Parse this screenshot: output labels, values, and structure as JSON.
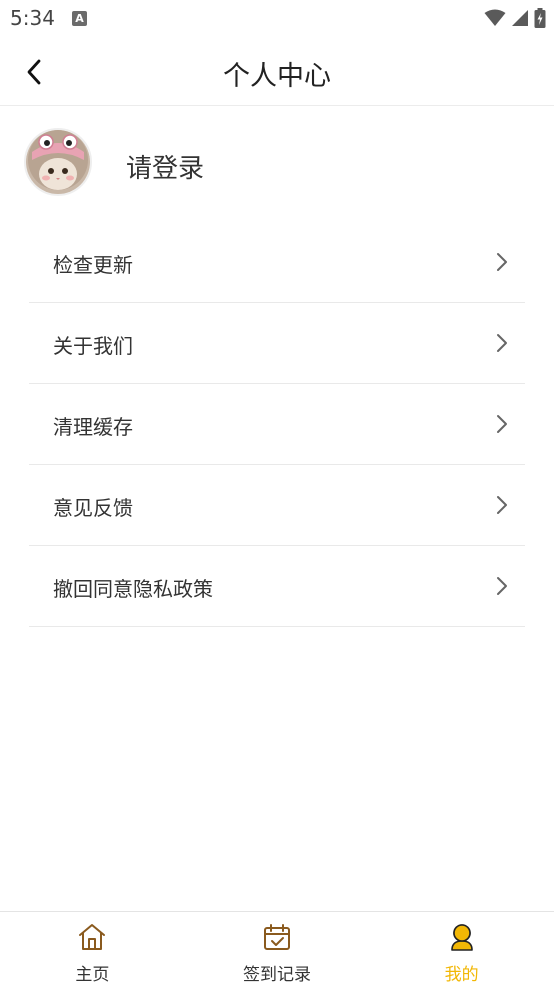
{
  "status_bar": {
    "time": "5:34",
    "notif_letter": "A"
  },
  "header": {
    "title": "个人中心",
    "back_icon": "chevron-left-icon"
  },
  "profile": {
    "login_text": "请登录",
    "avatar": "avatar-cat-image"
  },
  "menu": {
    "items": [
      {
        "label": "检查更新"
      },
      {
        "label": "关于我们"
      },
      {
        "label": "清理缓存"
      },
      {
        "label": "意见反馈"
      },
      {
        "label": "撤回同意隐私政策"
      }
    ]
  },
  "tabbar": {
    "tabs": [
      {
        "label": "主页",
        "icon": "home-icon",
        "active": false
      },
      {
        "label": "签到记录",
        "icon": "calendar-check-icon",
        "active": false
      },
      {
        "label": "我的",
        "icon": "user-icon",
        "active": true
      }
    ]
  },
  "colors": {
    "accent": "#f2b705",
    "icon_brown": "#8a5a1e",
    "divider": "#e9e9e9"
  }
}
